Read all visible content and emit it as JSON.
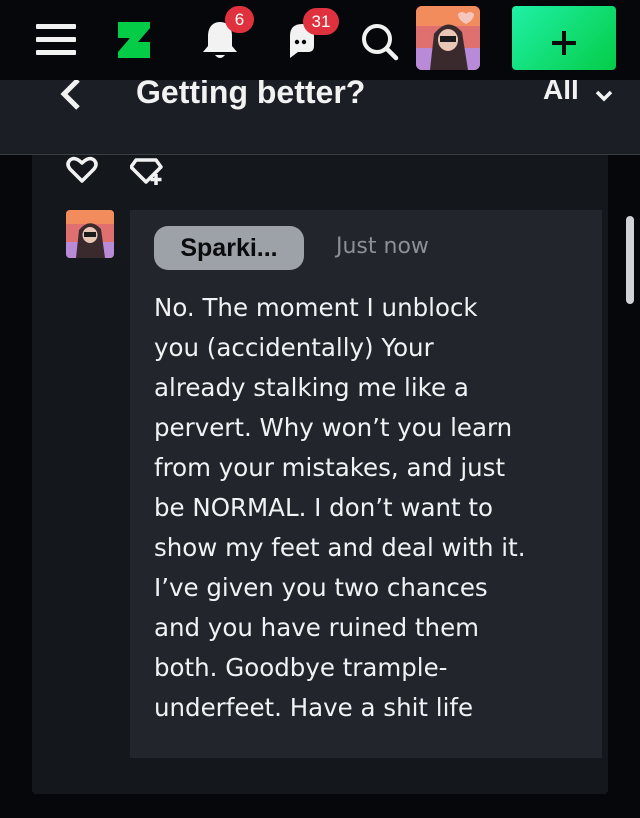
{
  "topbar": {
    "notifications_count": "6",
    "messages_count": "31",
    "icons": [
      "menu-icon",
      "deviantart-logo-icon",
      "bell-icon",
      "chat-icon",
      "search-icon",
      "avatar",
      "plus-icon"
    ],
    "submit_button_color": "#19e58a"
  },
  "subheader": {
    "title": "Getting better?",
    "filter_label": "All"
  },
  "comment": {
    "username": "Sparki...",
    "timestamp": "Just now",
    "body": "No. The moment I unblock\nyou (accidentally) Your\nalready stalking me like a\npervert.   Why won’t you learn\nfrom your mistakes, and just\nbe NORMAL. I don’t want to\nshow my feet and deal with it.\nI’ve given you two chances\nand you have ruined them\nboth. Goodbye trample-\nunderfeet. Have a shit life"
  },
  "colors": {
    "background": "#06070a",
    "panel": "#14171c",
    "comment_box": "#22262c",
    "badge": "#e0323e",
    "accent_green": "#05cc47"
  }
}
